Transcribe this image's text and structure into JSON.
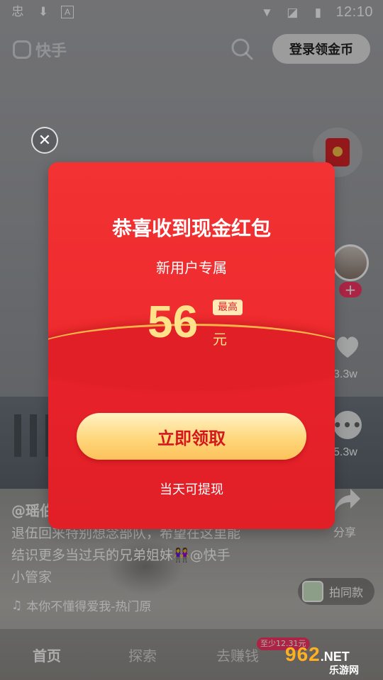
{
  "status_bar": {
    "time": "12:10"
  },
  "top_bar": {
    "logo_text": "快手",
    "login_button": "登录领金币"
  },
  "modal": {
    "title": "恭喜收到现金红包",
    "subtitle": "新用户专属",
    "amount": "56",
    "badge": "最高",
    "unit": "元",
    "claim_button": "立即领取",
    "footer": "当天可提现"
  },
  "side_rail": {
    "like_count": "3.3w",
    "comment_count": "5.3w",
    "share_label": "分享",
    "same_style_button": "拍同款"
  },
  "video": {
    "author": "@瑶伯",
    "caption_line1": "退伍回来特别想念部队，希望在这里能",
    "caption_line2": "结识更多当过兵的兄弟姐妹👭@快手",
    "caption_line3": "小管家",
    "music": "本你不懂得爱我-热门原"
  },
  "bottom_nav": {
    "items": [
      "首页",
      "探索",
      "去赚钱"
    ],
    "earn_badge": "至少12.31元"
  },
  "watermark": {
    "big": "962",
    "suffix": ".NET",
    "small": "乐游网"
  },
  "colors": {
    "modal_red": "#e8222a",
    "gold": "#ffe28a",
    "accent_pink": "#fe3666"
  }
}
